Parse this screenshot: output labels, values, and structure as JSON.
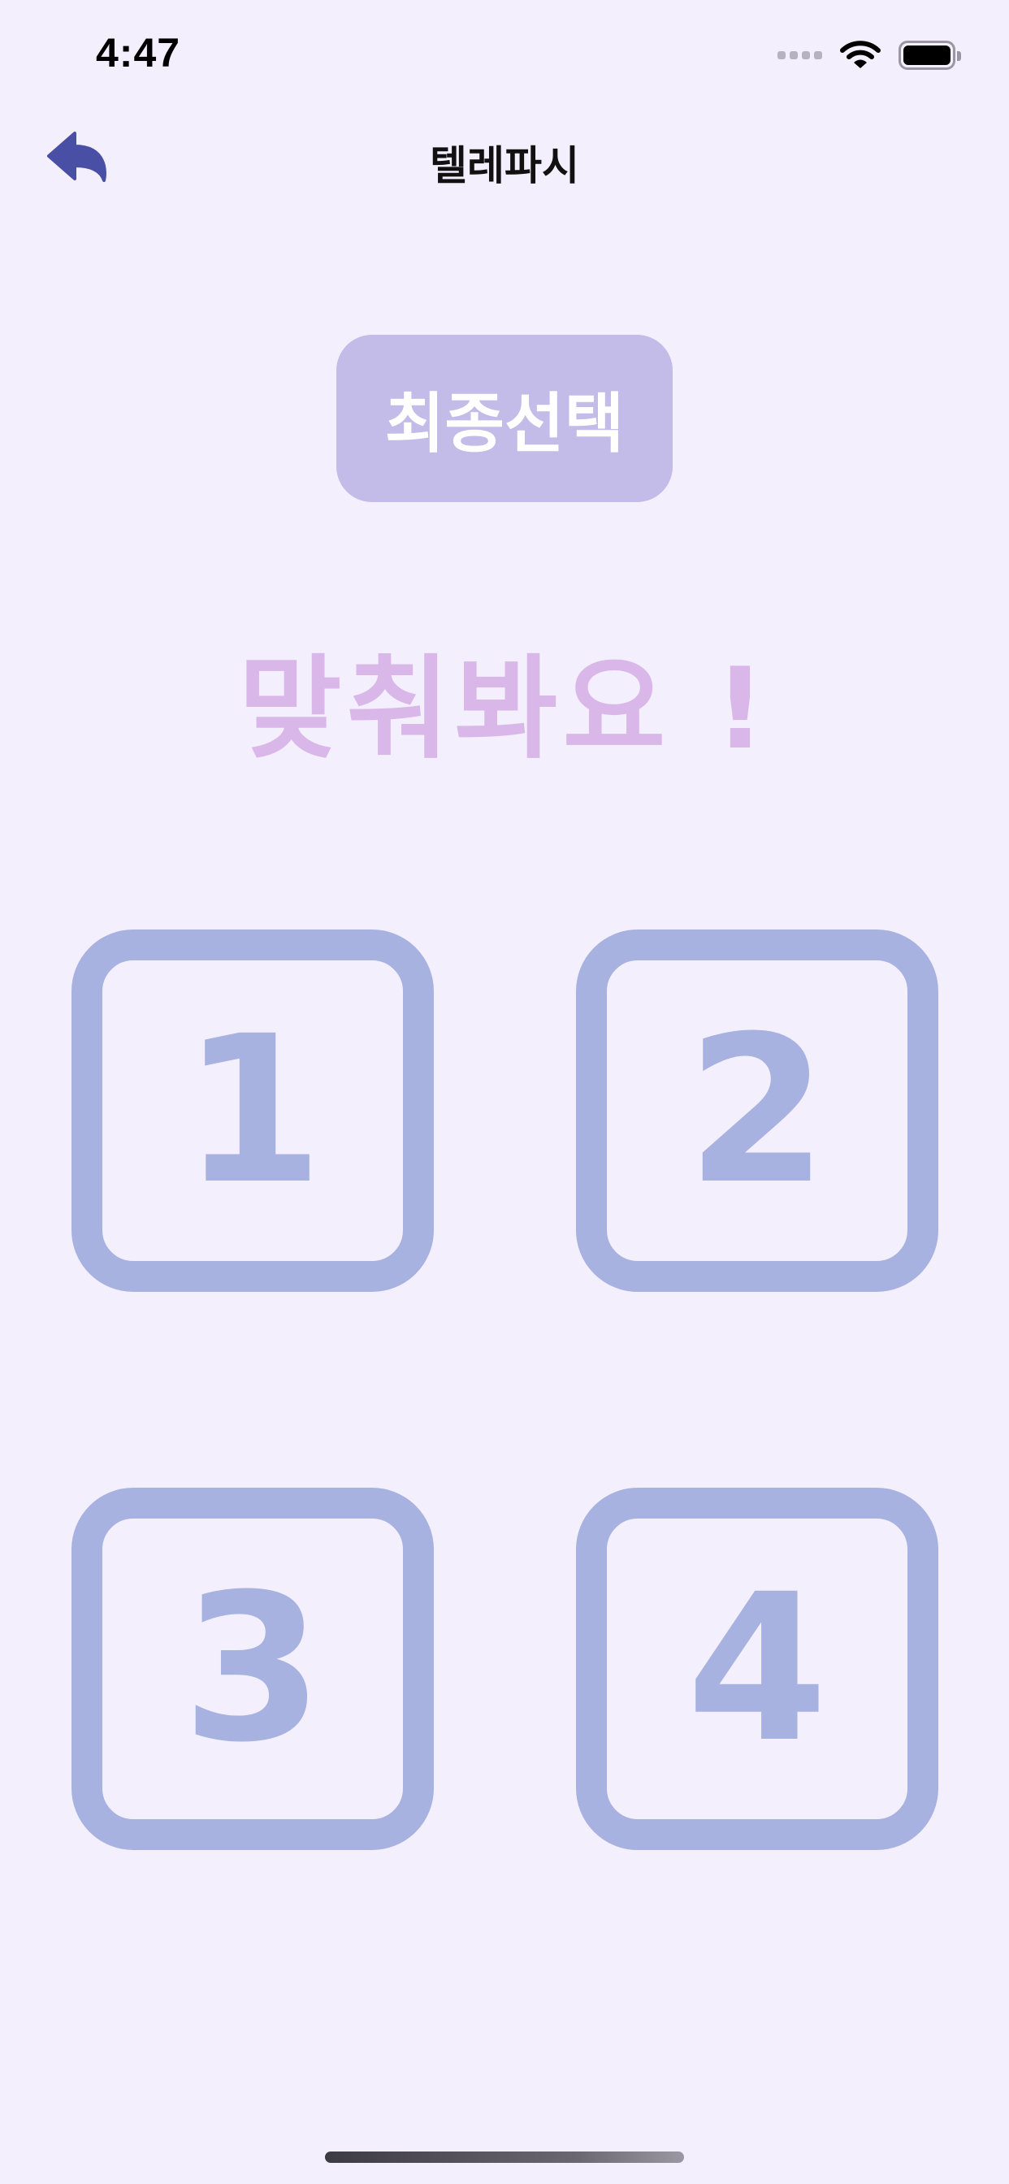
{
  "status_bar": {
    "time": "4:47"
  },
  "nav": {
    "title": "텔레파시",
    "back_icon": "back-arrow-icon"
  },
  "final_button": {
    "label": "최종선택"
  },
  "headline": "맞춰봐요 !",
  "choices": [
    {
      "label": "1"
    },
    {
      "label": "2"
    },
    {
      "label": "3"
    },
    {
      "label": "4"
    }
  ],
  "colors": {
    "background": "#f4effc",
    "accent_button": "#c3bbe8",
    "headline": "#d9b8e9",
    "choice": "#a8b2e0",
    "back_icon": "#4a4fa6"
  }
}
